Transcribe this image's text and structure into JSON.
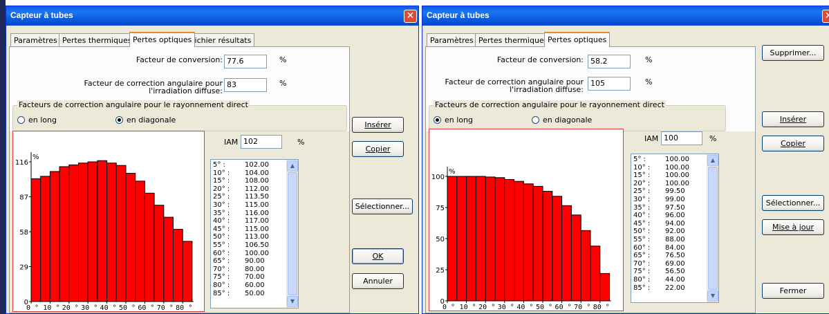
{
  "left": {
    "title": "Capteur à tubes",
    "tabs": [
      "Paramètres",
      "Pertes thermiques",
      "Pertes optiques",
      "Fichier résultats"
    ],
    "active_tab": 2,
    "conversion": {
      "label": "Facteur de conversion:",
      "value": "77.6",
      "unit": "%"
    },
    "diffuse": {
      "label1": "Facteur de correction angulaire pour",
      "label2": "l'irradiation diffuse:",
      "value": "83",
      "unit": "%"
    },
    "group_label": "Facteurs de correction angulaire pour le rayonnement direct",
    "radio_long": "en long",
    "radio_diag": "en diagonale",
    "radio_selected": "diag",
    "iam": {
      "label": "IAM",
      "value": "102",
      "unit": "%"
    },
    "list": [
      [
        "5° :",
        "102.00"
      ],
      [
        "10° :",
        "104.00"
      ],
      [
        "15° :",
        "108.00"
      ],
      [
        "20° :",
        "112.00"
      ],
      [
        "25° :",
        "113.50"
      ],
      [
        "30° :",
        "115.00"
      ],
      [
        "35° :",
        "116.00"
      ],
      [
        "40° :",
        "117.00"
      ],
      [
        "45° :",
        "115.00"
      ],
      [
        "50° :",
        "113.00"
      ],
      [
        "55° :",
        "106.50"
      ],
      [
        "60° :",
        "100.00"
      ],
      [
        "65° :",
        "90.00"
      ],
      [
        "70° :",
        "80.00"
      ],
      [
        "75° :",
        "70.00"
      ],
      [
        "80° :",
        "60.00"
      ],
      [
        "85° :",
        "50.00"
      ]
    ],
    "buttons": {
      "inserer": "Insérer",
      "copier": "Copier",
      "selectionner": "Sélectionner...",
      "ok": "OK",
      "annuler": "Annuler"
    }
  },
  "right": {
    "title": "Capteur à tubes",
    "tabs": [
      "Paramètres",
      "Pertes thermiques",
      "Pertes optiques"
    ],
    "active_tab": 2,
    "conversion": {
      "label": "Facteur de conversion:",
      "value": "58.2",
      "unit": "%"
    },
    "diffuse": {
      "label1": "Facteur de correction angulaire pour",
      "label2": "l'irradiation diffuse:",
      "value": "105",
      "unit": "%"
    },
    "group_label": "Facteurs de correction angulaire pour le rayonnement direct",
    "radio_long": "en long",
    "radio_diag": "en diagonale",
    "radio_selected": "long",
    "iam": {
      "label": "IAM",
      "value": "100",
      "unit": "%"
    },
    "list": [
      [
        "5° :",
        "100.00"
      ],
      [
        "10° :",
        "100.00"
      ],
      [
        "15° :",
        "100.00"
      ],
      [
        "20° :",
        "100.00"
      ],
      [
        "25° :",
        "99.50"
      ],
      [
        "30° :",
        "99.00"
      ],
      [
        "35° :",
        "97.50"
      ],
      [
        "40° :",
        "96.00"
      ],
      [
        "45° :",
        "94.00"
      ],
      [
        "50° :",
        "92.00"
      ],
      [
        "55° :",
        "88.00"
      ],
      [
        "60° :",
        "84.00"
      ],
      [
        "65° :",
        "76.50"
      ],
      [
        "70° :",
        "69.00"
      ],
      [
        "75° :",
        "56.50"
      ],
      [
        "80° :",
        "44.00"
      ],
      [
        "85° :",
        "22.00"
      ]
    ],
    "buttons": {
      "supprimer": "Supprimer...",
      "inserer": "Insérer",
      "copier": "Copier",
      "selectionner": "Sélectionner...",
      "mise_a_jour": "Mise à jour",
      "fermer": "Fermer"
    }
  },
  "chart_data": [
    {
      "type": "bar",
      "ylabel": "%",
      "categories": [
        "5",
        "10",
        "15",
        "20",
        "25",
        "30",
        "35",
        "40",
        "45",
        "50",
        "55",
        "60",
        "65",
        "70",
        "75",
        "80",
        "85"
      ],
      "values": [
        102,
        104,
        108,
        112,
        113.5,
        115,
        116,
        117,
        115,
        113,
        106.5,
        100,
        90,
        80,
        70,
        60,
        50
      ],
      "yticks": [
        0,
        29,
        58,
        87,
        116
      ],
      "ylim": [
        0,
        116
      ],
      "xticks": [
        "0 °",
        "10 °",
        "20 °",
        "30 °",
        "40 °",
        "50 °",
        "60 °",
        "70 °",
        "80 °"
      ],
      "bar_color": "#ff0000"
    },
    {
      "type": "bar",
      "ylabel": "%",
      "categories": [
        "5",
        "10",
        "15",
        "20",
        "25",
        "30",
        "35",
        "40",
        "45",
        "50",
        "55",
        "60",
        "65",
        "70",
        "75",
        "80",
        "85"
      ],
      "values": [
        100,
        100,
        100,
        100,
        99.5,
        99,
        97.5,
        96,
        94,
        92,
        88,
        84,
        76.5,
        69,
        56.5,
        44,
        22
      ],
      "yticks": [
        0,
        25,
        50,
        75,
        100
      ],
      "ylim": [
        0,
        100
      ],
      "xticks": [
        "0 °",
        "10 °",
        "20 °",
        "30 °",
        "40 °",
        "50 °",
        "60 °",
        "70 °",
        "80 °"
      ],
      "bar_color": "#ff0000"
    }
  ]
}
